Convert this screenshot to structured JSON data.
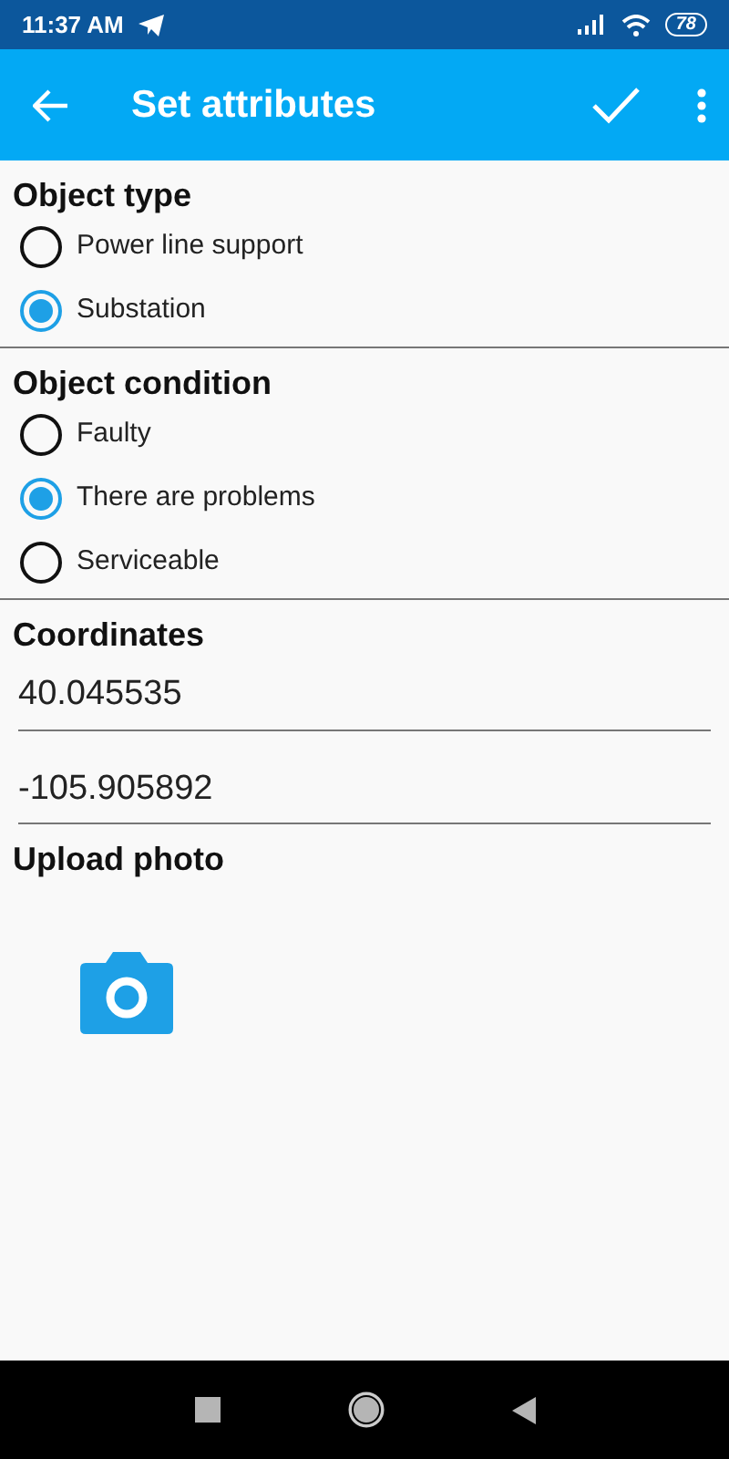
{
  "status_bar": {
    "time": "11:37 AM",
    "battery": "78"
  },
  "app_bar": {
    "title": "Set attributes"
  },
  "sections": [
    {
      "kind": "radio",
      "title": "Object type",
      "options": [
        {
          "label": "Power line support",
          "selected": false
        },
        {
          "label": "Substation",
          "selected": true
        }
      ]
    },
    {
      "kind": "radio",
      "title": "Object condition",
      "options": [
        {
          "label": "Faulty",
          "selected": false
        },
        {
          "label": "There are problems",
          "selected": true
        },
        {
          "label": "Serviceable",
          "selected": false
        }
      ]
    },
    {
      "kind": "fields",
      "title": "Coordinates",
      "fields": [
        {
          "value": "40.045535"
        },
        {
          "value": "-105.905892"
        }
      ]
    },
    {
      "kind": "photo",
      "title": "Upload photo"
    }
  ]
}
